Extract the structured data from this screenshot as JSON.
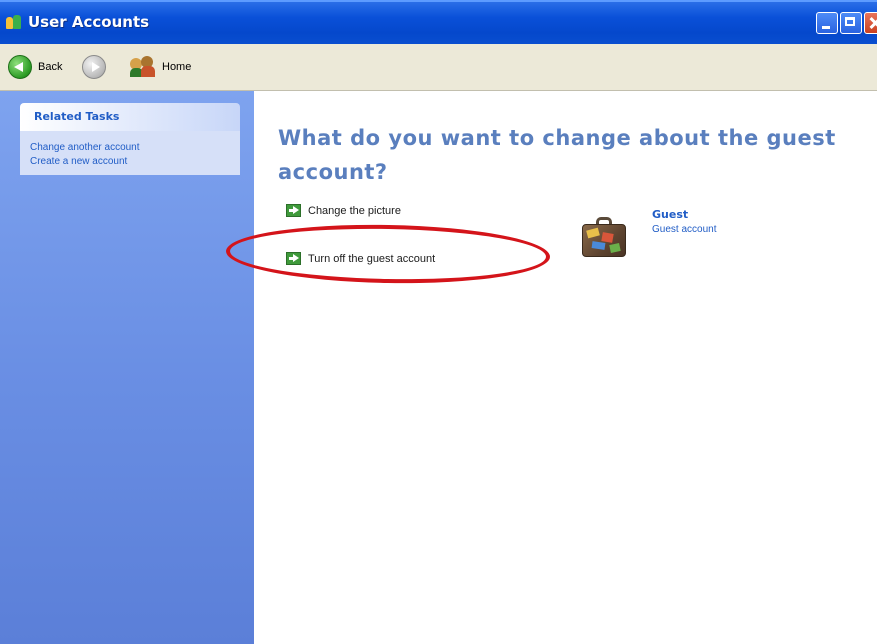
{
  "window": {
    "title": "User Accounts"
  },
  "toolbar": {
    "back_label": "Back",
    "home_label": "Home"
  },
  "sidebar": {
    "related_tasks": {
      "heading": "Related Tasks",
      "links": [
        "Change another account",
        "Create a new account"
      ]
    }
  },
  "main": {
    "title": "What do you want to change about the guest account?",
    "tasks": [
      "Change the picture",
      "Turn off the guest account"
    ],
    "account": {
      "name": "Guest",
      "type": "Guest account"
    }
  },
  "colors": {
    "titlebar": "#0a50d8",
    "sidebar": "#6a8fe4",
    "link": "#215dc6",
    "annotation": "#d4141a"
  }
}
